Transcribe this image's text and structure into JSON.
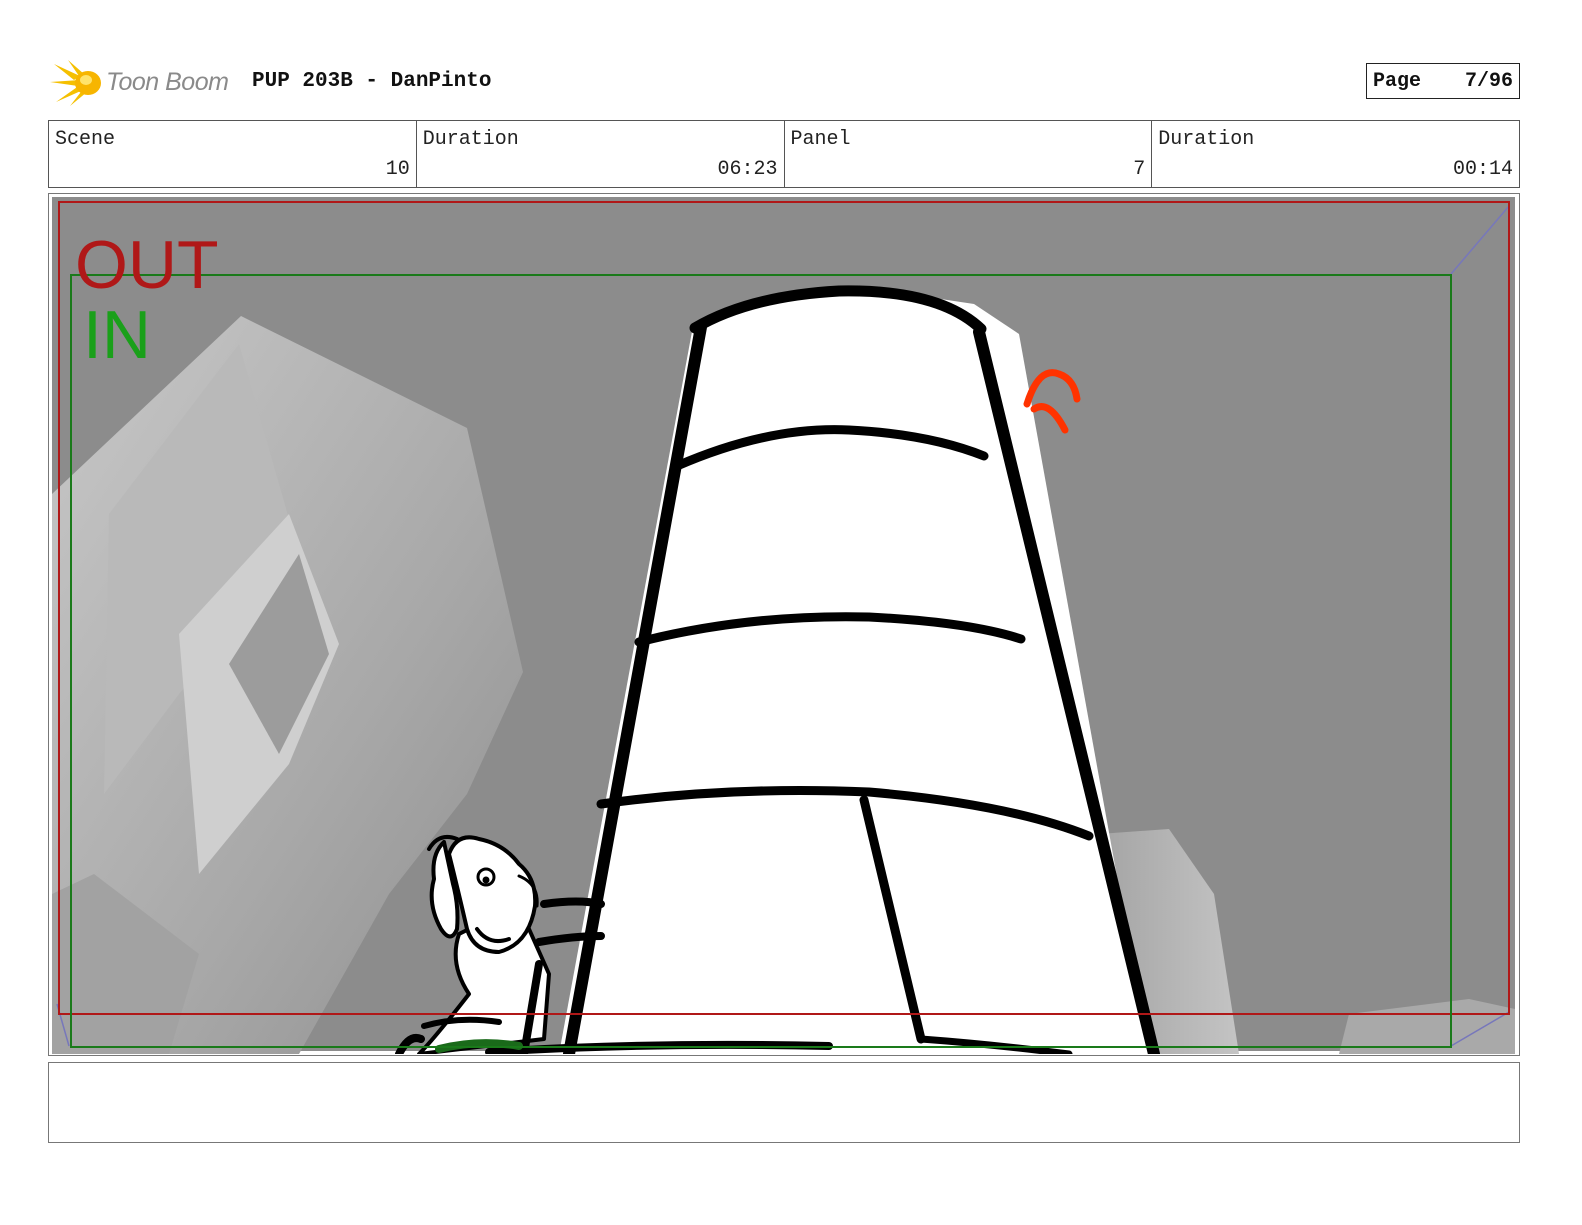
{
  "header": {
    "logo_text": "Toon Boom",
    "project_title": "PUP 203B - DanPinto",
    "page_label": "Page",
    "page_number": "7/96"
  },
  "info": {
    "scene_label": "Scene",
    "scene_value": "10",
    "scene_duration_label": "Duration",
    "scene_duration_value": "06:23",
    "panel_label": "Panel",
    "panel_value": "7",
    "panel_duration_label": "Duration",
    "panel_duration_value": "00:14"
  },
  "panel": {
    "out_label": "OUT",
    "in_label": "IN",
    "colors": {
      "out_frame": "#b01818",
      "in_frame": "#1a7a1a",
      "arrow": "#ff3300",
      "background": "#8c8c8c"
    }
  },
  "notes": {
    "text": ""
  }
}
